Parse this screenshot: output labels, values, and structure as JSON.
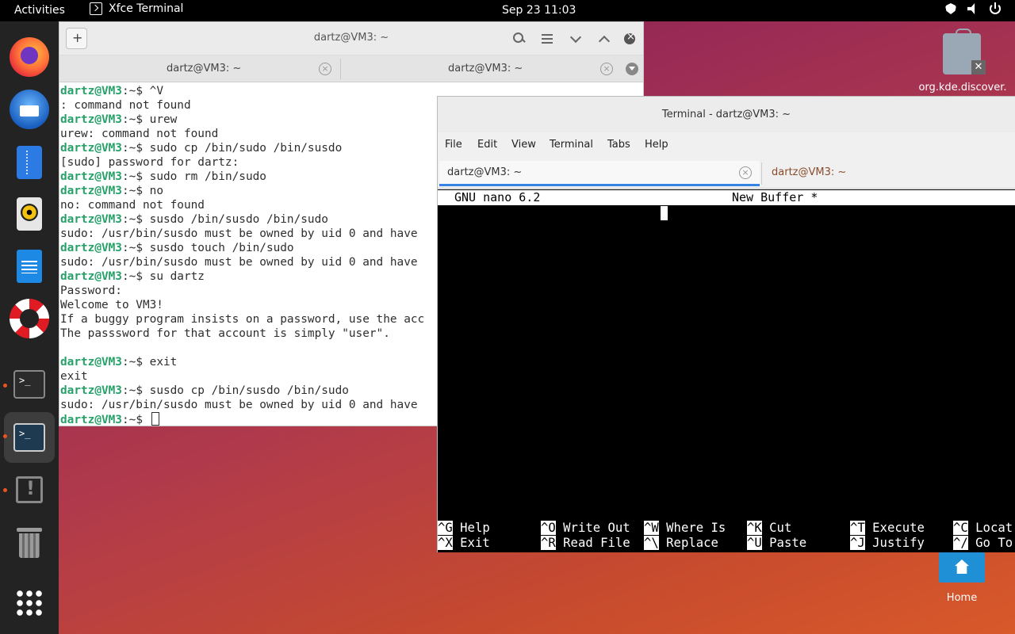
{
  "topbar": {
    "activities": "Activities",
    "app_name": "Xfce Terminal",
    "clock": "Sep 23  11:03"
  },
  "dock": {
    "items": [
      "firefox-icon",
      "thunderbird-icon",
      "files-icon",
      "rhythmbox-icon",
      "libreoffice-writer-icon",
      "help-icon",
      "terminal-icon",
      "xfce-terminal-icon",
      "software-updater-icon",
      "trash-icon",
      "show-apps-icon"
    ]
  },
  "desktop": {
    "discover_label": "org.kde.discover.",
    "home_label": "Home"
  },
  "win1": {
    "title": "dartz@VM3: ~",
    "tabs": [
      "dartz@VM3: ~",
      "dartz@VM3: ~"
    ],
    "prompt": "dartz@VM3",
    "lines": [
      {
        "p": true,
        "cmd": "$ ^V"
      },
      {
        "p": false,
        "text": ": command not found"
      },
      {
        "p": true,
        "cmd": "$ urew"
      },
      {
        "p": false,
        "text": "urew: command not found"
      },
      {
        "p": true,
        "cmd": "$ sudo cp /bin/sudo /bin/susdo"
      },
      {
        "p": false,
        "text": "[sudo] password for dartz:"
      },
      {
        "p": true,
        "cmd": "$ sudo rm /bin/sudo"
      },
      {
        "p": true,
        "cmd": "$ no"
      },
      {
        "p": false,
        "text": "no: command not found"
      },
      {
        "p": true,
        "cmd": "$ susdo /bin/susdo /bin/sudo"
      },
      {
        "p": false,
        "text": "sudo: /usr/bin/susdo must be owned by uid 0 and have"
      },
      {
        "p": true,
        "cmd": "$ susdo touch /bin/sudo"
      },
      {
        "p": false,
        "text": "sudo: /usr/bin/susdo must be owned by uid 0 and have"
      },
      {
        "p": true,
        "cmd": "$ su dartz"
      },
      {
        "p": false,
        "text": "Password:"
      },
      {
        "p": false,
        "text": "Welcome to VM3!"
      },
      {
        "p": false,
        "text": "If a buggy program insists on a password, use the acc"
      },
      {
        "p": false,
        "text": "The passsword for that account is simply \"user\"."
      },
      {
        "p": false,
        "text": ""
      },
      {
        "p": true,
        "cmd": "$ exit"
      },
      {
        "p": false,
        "text": "exit"
      },
      {
        "p": true,
        "cmd": "$ susdo cp /bin/susdo /bin/sudo"
      },
      {
        "p": false,
        "text": "sudo: /usr/bin/susdo must be owned by uid 0 and have"
      },
      {
        "p": true,
        "cmd": "$ ",
        "cursor": true
      }
    ]
  },
  "win2": {
    "title": "Terminal - dartz@VM3: ~",
    "menu": [
      "File",
      "Edit",
      "View",
      "Terminal",
      "Tabs",
      "Help"
    ],
    "tabs": [
      "dartz@VM3: ~",
      "dartz@VM3: ~"
    ],
    "nano_title_left": "GNU nano 6.2",
    "nano_title_right": "New Buffer *",
    "shortcuts_row1": [
      {
        "key": "^G",
        "label": "Help"
      },
      {
        "key": "^O",
        "label": "Write Out"
      },
      {
        "key": "^W",
        "label": "Where Is"
      },
      {
        "key": "^K",
        "label": "Cut"
      },
      {
        "key": "^T",
        "label": "Execute"
      },
      {
        "key": "^C",
        "label": "Locat"
      }
    ],
    "shortcuts_row2": [
      {
        "key": "^X",
        "label": "Exit"
      },
      {
        "key": "^R",
        "label": "Read File"
      },
      {
        "key": "^\\",
        "label": "Replace"
      },
      {
        "key": "^U",
        "label": "Paste"
      },
      {
        "key": "^J",
        "label": "Justify"
      },
      {
        "key": "^/",
        "label": "Go To"
      }
    ]
  }
}
